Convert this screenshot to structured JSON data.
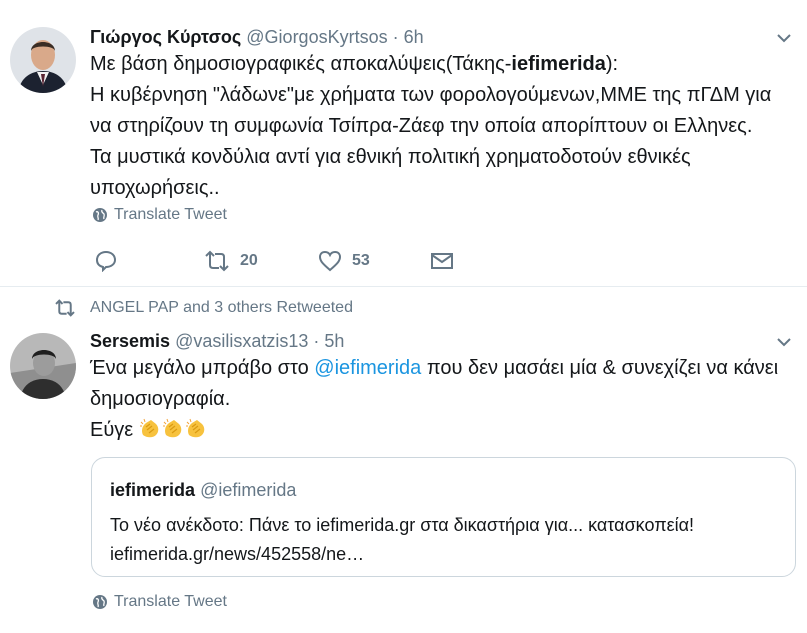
{
  "tweets": [
    {
      "author_name": "Γιώργος Κύρτσος",
      "handle": "@GiorgosKyrtsos",
      "separator": "·",
      "time": "6h",
      "line1_before": "Με βάση δημοσιογραφικές αποκαλύψεις(Τάκης-",
      "line1_bold": "iefimerida",
      "line1_after": "):",
      "line2": "Η κυβέρνηση \"λάδωνε\"με χρήματα των φορολογούμενων,ΜΜΕ της πΓΔΜ για",
      "line3": "να στηρίζουν τη συμφωνία Τσίπρα-Ζάεφ την οποία απορίπτουν οι Ελληνες.",
      "line4": "Τα μυστικά κονδύλια αντί για εθνική πολιτική χρηματοδοτούν εθνικές",
      "line5": "υποχωρήσεις..",
      "translate_label": "Translate Tweet",
      "retweet_count": "20",
      "like_count": "53"
    },
    {
      "retweeted_by": "ANGEL PAP and 3 others Retweeted",
      "author_name": "Sersemis",
      "handle": "@vasilisxatzis13",
      "separator": "·",
      "time": "5h",
      "line1_before": "Ένα μεγάλο μπράβο στο ",
      "line1_mention": "@iefimerida",
      "line1_after": " που δεν μασάει μία & συνεχίζει να κάνει",
      "line2": "δημοσιογραφία.",
      "line3": "Εύγε",
      "translate_label": "Translate Tweet",
      "quote": {
        "author_name": "iefimerida",
        "handle": "@iefimerida",
        "text": "Το νέο ανέκδοτο: Πάνε το iefimerida.gr στα δικαστήρια για... κατασκοπεία!",
        "link": "iefimerida.gr/news/452558/ne…"
      }
    }
  ],
  "icons": {
    "caret": "chevron-down-icon",
    "globe": "globe-icon",
    "reply": "reply-icon",
    "retweet": "retweet-icon",
    "like": "heart-icon",
    "dm": "envelope-icon",
    "clap": "clapping-hands-emoji"
  },
  "colors": {
    "text": "#14171a",
    "secondary": "#657786",
    "link": "#1b95e0",
    "divider": "#e6ecf0",
    "clap": "#f7c23e"
  }
}
